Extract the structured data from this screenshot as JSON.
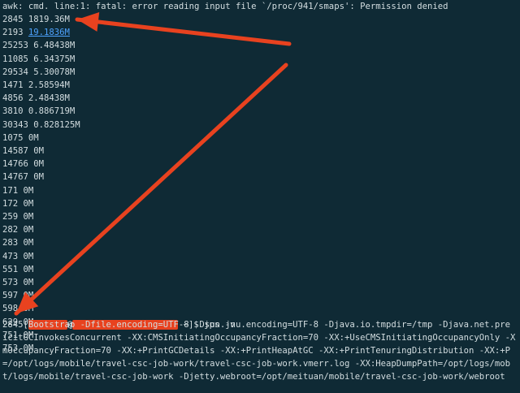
{
  "terminal": {
    "error_line": "awk: cmd. line:1: fatal: error reading input file `/proc/941/smaps': Permission denied",
    "mem_rows": [
      {
        "pid": "2845",
        "mem": "1819.36M",
        "link": false
      },
      {
        "pid": "2193",
        "mem": "19.1836M",
        "link": true
      },
      {
        "pid": "25253",
        "mem": "6.48438M",
        "link": false
      },
      {
        "pid": "11085",
        "mem": "6.34375M",
        "link": false
      },
      {
        "pid": "29534",
        "mem": "5.30078M",
        "link": false
      },
      {
        "pid": "1471",
        "mem": "2.58594M",
        "link": false
      },
      {
        "pid": "4856",
        "mem": "2.48438M",
        "link": false
      },
      {
        "pid": "3810",
        "mem": "0.886719M",
        "link": false
      },
      {
        "pid": "30343",
        "mem": "0.828125M",
        "link": false
      },
      {
        "pid": "1075",
        "mem": "0M",
        "link": false
      },
      {
        "pid": "14587",
        "mem": "0M",
        "link": false
      },
      {
        "pid": "14766",
        "mem": "0M",
        "link": false
      },
      {
        "pid": "14767",
        "mem": "0M",
        "link": false
      },
      {
        "pid": "171",
        "mem": "0M",
        "link": false
      },
      {
        "pid": "172",
        "mem": "0M",
        "link": false
      },
      {
        "pid": "259",
        "mem": "0M",
        "link": false
      },
      {
        "pid": "282",
        "mem": "0M",
        "link": false
      },
      {
        "pid": "283",
        "mem": "0M",
        "link": false
      },
      {
        "pid": "473",
        "mem": "0M",
        "link": false
      },
      {
        "pid": "551",
        "mem": "0M",
        "link": false
      },
      {
        "pid": "573",
        "mem": "0M",
        "link": false
      },
      {
        "pid": "597",
        "mem": "0M",
        "link": false
      },
      {
        "pid": "598",
        "mem": "0M",
        "link": false
      },
      {
        "pid": "629",
        "mem": "0M",
        "link": false
      },
      {
        "pid": "751",
        "mem": "0M",
        "link": false
      },
      {
        "pid": "753",
        "mem": "0M",
        "link": false
      }
    ],
    "prompt": {
      "open_bracket": "[",
      "at_sign": "@",
      "suffix": " ~]$ jps -v"
    },
    "output_lines": [
      "2845 Bootstrap -Dfile.encoding=UTF-8 -Dsun.jnu.encoding=UTF-8 -Djava.io.tmpdir=/tmp -Djava.net.pre",
      "icitGCInvokesConcurrent -XX:CMSInitiatingOccupancyFraction=70 -XX:+UseCMSInitiatingOccupancyOnly -X",
      "mOccupancyFraction=70 -XX:+PrintGCDetails -XX:+PrintHeapAtGC -XX:+PrintTenuringDistribution -XX:+P",
      "=/opt/logs/mobile/travel-csc-job-work/travel-csc-job-work.vmerr.log -XX:HeapDumpPath=/opt/logs/mob",
      "t/logs/mobile/travel-csc-job-work -Djetty.webroot=/opt/meituan/mobile/travel-csc-job-work/webroot"
    ],
    "annotation_color": "#e8421f"
  }
}
